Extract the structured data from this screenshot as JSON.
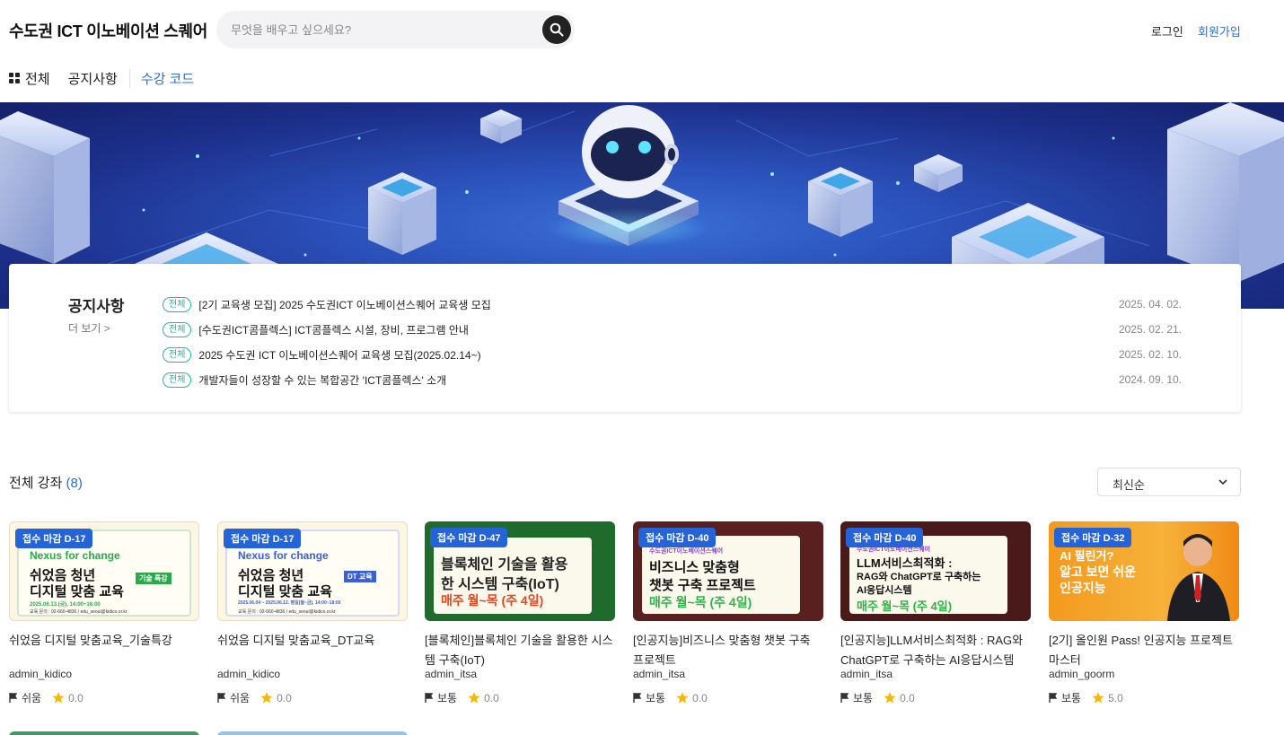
{
  "header": {
    "site_title": "수도권 ICT 이노베이션 스퀘어",
    "search_placeholder": "무엇을 배우고 싶으세요?",
    "login": "로그인",
    "signup": "회원가입"
  },
  "nav": {
    "all": "전체",
    "notice": "공지사항",
    "code": "수강 코드"
  },
  "notice": {
    "heading": "공지사항",
    "more": "더 보기  >",
    "items": [
      {
        "badge": "전체",
        "title": "[2기 교육생 모집] 2025 수도권ICT 이노베이션스퀘어 교육생 모집",
        "date": "2025. 04. 02."
      },
      {
        "badge": "전체",
        "title": "[수도권ICT콤플렉스] ICT콤플렉스 시설, 장비, 프로그램 안내",
        "date": "2025. 02. 21."
      },
      {
        "badge": "전체",
        "title": "2025 수도권 ICT 이노베이션스퀘어 교육생 모집(2025.02.14~)",
        "date": "2025. 02. 10."
      },
      {
        "badge": "전체",
        "title": "개발자들이 성장할 수 있는 복합공간 'ICT콤플렉스' 소개",
        "date": "2024. 09. 10."
      }
    ]
  },
  "courses": {
    "section_title": "전체 강좌",
    "count": "(8)",
    "sort_selected": "최신순",
    "items": [
      {
        "dday": "접수 마감 D-17",
        "title": "쉬었음 디지털 맞춤교육_기술특강",
        "author": "admin_kidico",
        "level": "쉬움",
        "rating": "0.0",
        "thumb": {
          "line1": "Nexus for change",
          "line2": "쉬었음 청년",
          "line3": "디지털 맞춤 교육",
          "tag": "기술 특강",
          "date": "2025.06.13.(금), 14:00~16:00",
          "contact": "교육 문의 : 02-660-4836 / edu_seoul@kidico.or.kr"
        },
        "colors": {
          "bg": "#f7f3e3",
          "accent": "#2aa84a"
        }
      },
      {
        "dday": "접수 마감 D-17",
        "title": "쉬었음 디지털 맞춤교육_DT교육",
        "author": "admin_kidico",
        "level": "쉬움",
        "rating": "0.0",
        "thumb": {
          "line1": "Nexus for change",
          "line2": "쉬었음 청년",
          "line3": "디지털 맞춤 교육",
          "tag": "DT 교육",
          "date": "2025.06.04 ~ 2025.06.12. 평일(월~금), 14:00~18:00",
          "contact": "교육 문의 : 02-660-4836 / edu_seoul@kidico.or.kr"
        },
        "colors": {
          "bg": "#f7f3e3",
          "accent": "#3b5fd6"
        }
      },
      {
        "dday": "접수 마감 D-47",
        "title": "[블록체인]블록체인 기술을 활용한 시스템 구축(IoT)",
        "author": "admin_itsa",
        "level": "보통",
        "rating": "0.0",
        "thumb": {
          "line1": "블록체인 기술을 활용",
          "line2": "한 시스템 구축(IoT)",
          "line3": "매주 월~목 (주 4일)"
        },
        "colors": {
          "bg": "#1f6b2c",
          "accent": "#e8451e"
        }
      },
      {
        "dday": "접수 마감 D-40",
        "title": "[인공지능]비즈니스 맞춤형 챗봇 구축 프로젝트",
        "author": "admin_itsa",
        "level": "보통",
        "rating": "0.0",
        "thumb": {
          "small": "수도권ICT이노베이션스퀘어",
          "line1": "비즈니스 맞춤형",
          "line2": "챗봇 구축 프로젝트",
          "line3": "매주 월~목 (주 4일)"
        },
        "colors": {
          "bg": "#5a1f1f",
          "accent": "#2fb34a"
        }
      },
      {
        "dday": "접수 마감 D-40",
        "title": "[인공지능]LLM서비스최적화 : RAG와 ChatGPT로 구축하는 AI응답시스템",
        "author": "admin_itsa",
        "level": "보통",
        "rating": "0.0",
        "thumb": {
          "small": "수도권ICT이노베이션스퀘어",
          "line1": "LLM서비스최적화 :",
          "line2": "RAG와 ChatGPT로 구축하는",
          "line3": "AI응답시스템",
          "line4": "매주 월~목 (주 4일)"
        },
        "colors": {
          "bg": "#4a1a1a",
          "accent": "#2fb34a"
        }
      },
      {
        "dday": "접수 마감 D-32",
        "title": "[2기] 올인원 Pass! 인공지능 프로젝트 마스터",
        "author": "admin_goorm",
        "level": "보통",
        "rating": "5.0",
        "thumb": {
          "line1": "AI 필린거?",
          "line2": "알고 보면 쉬운",
          "line3": "인공지능"
        },
        "colors": {
          "bg": "#f39a1e",
          "accent": "#ffffff"
        }
      }
    ]
  },
  "colors": {
    "brand_blue": "#2b6fd6",
    "dday_badge": "#2563d8",
    "notice_badge": "#2bb3a3",
    "star": "#f5b800"
  }
}
